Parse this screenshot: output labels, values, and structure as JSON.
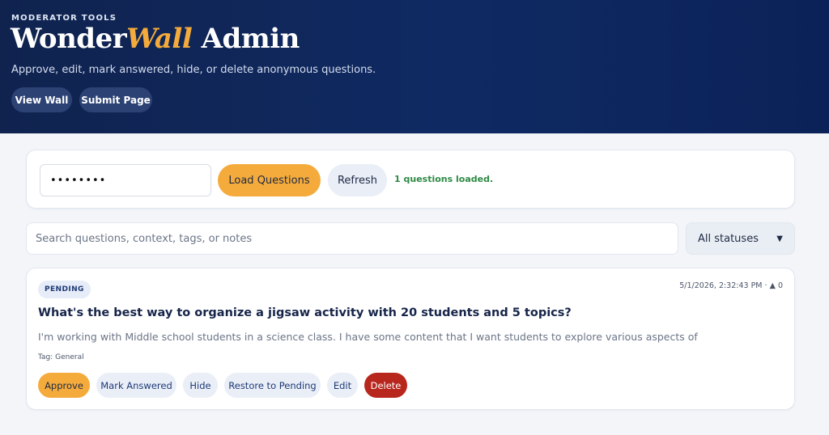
{
  "header": {
    "eyebrow": "MODERATOR TOOLS",
    "title_part1": "Wonder",
    "title_accent": "Wall",
    "title_part2": " Admin",
    "subtitle": "Approve, edit, mark answered, hide, or delete anonymous questions.",
    "nav": {
      "view_wall": "View Wall",
      "submit_page": "Submit Page"
    }
  },
  "auth": {
    "password_value": "••••••••",
    "load_label": "Load Questions",
    "refresh_label": "Refresh",
    "status_message": "1 questions loaded."
  },
  "filters": {
    "search_placeholder": "Search questions, context, tags, or notes",
    "status_selected": "All statuses"
  },
  "questions": [
    {
      "status": "PENDING",
      "timestamp": "5/1/2026, 2:32:43 PM",
      "separator": "·",
      "vote_icon": "▲",
      "votes": "0",
      "title": "What's the best way to organize a jigsaw activity with 20 students and 5 topics?",
      "context": "I'm working with Middle school students in a science class. I have some content that I want students to explore various aspects of",
      "tag": "Tag: General",
      "actions": {
        "approve": "Approve",
        "mark_answered": "Mark Answered",
        "hide": "Hide",
        "restore": "Restore to Pending",
        "edit": "Edit",
        "delete": "Delete"
      }
    }
  ],
  "colors": {
    "header_bg": "#0f2a63",
    "accent": "#f4ab3c",
    "success": "#2e8a45",
    "danger": "#b8271d"
  }
}
